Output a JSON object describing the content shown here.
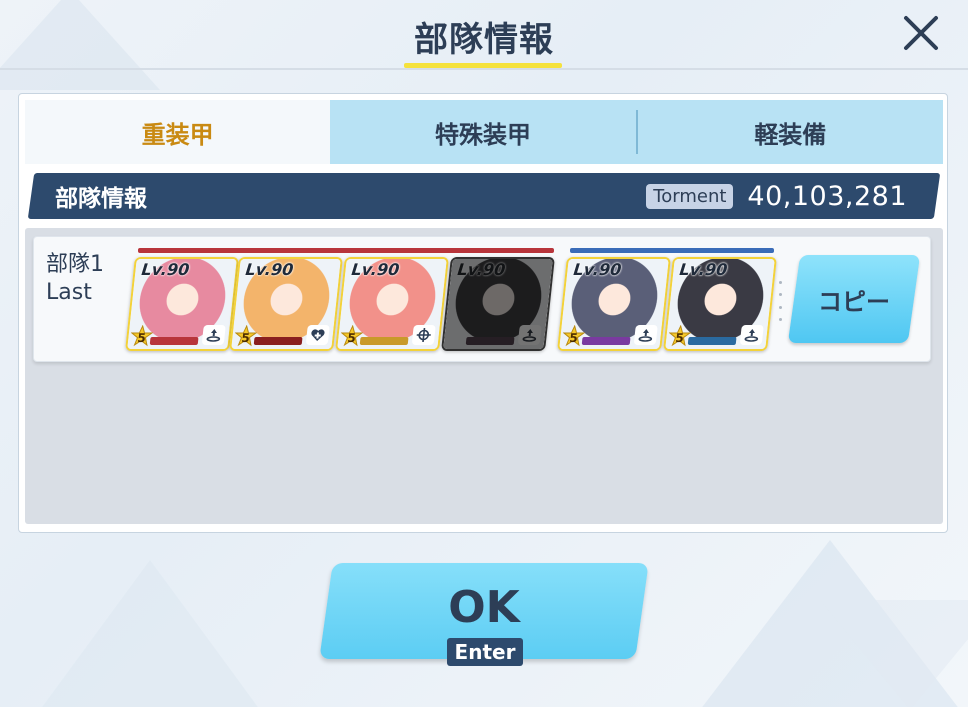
{
  "dialog": {
    "title": "部隊情報",
    "close_icon": "close-icon"
  },
  "tabs": [
    {
      "label": "重装甲",
      "active": true
    },
    {
      "label": "特殊装甲",
      "active": false
    },
    {
      "label": "軽装備",
      "active": false
    }
  ],
  "info_bar": {
    "title": "部隊情報",
    "mode_badge": "Torment",
    "score": "40,103,281"
  },
  "team": {
    "name": "部隊1",
    "sub_label": "Last",
    "copy_label": "コピー",
    "strikers": [
      {
        "level": "Lv.90",
        "star": "5",
        "role_icon": "tank-icon",
        "color": "#e78aa0",
        "strip": "#b8353b"
      },
      {
        "level": "Lv.90",
        "star": "5",
        "role_icon": "heal-icon",
        "color": "#f3b46b",
        "strip": "#8a1f1f"
      },
      {
        "level": "Lv.90",
        "star": "5",
        "role_icon": "crosshair-icon",
        "color": "#f2918a",
        "strip": "#c99a2a"
      },
      {
        "level": "Lv.90",
        "star": "",
        "role_icon": "tank-icon",
        "color": "#3d3d46",
        "strip": "#6a3a60",
        "dim": true
      }
    ],
    "specials": [
      {
        "level": "Lv.90",
        "star": "5",
        "role_icon": "tank-icon",
        "color": "#5a5f78",
        "strip": "#7a3aa0"
      },
      {
        "level": "Lv.90",
        "star": "5",
        "role_icon": "tank-icon",
        "color": "#3a3a44",
        "strip": "#2a6aa0"
      }
    ]
  },
  "ok_button": {
    "label": "OK",
    "shortcut": "Enter"
  },
  "colors": {
    "accent_yellow": "#f5e23c",
    "navy": "#2d4a6d",
    "active_tab_text": "#c98a12",
    "button_blue": "#5ccdf3"
  }
}
